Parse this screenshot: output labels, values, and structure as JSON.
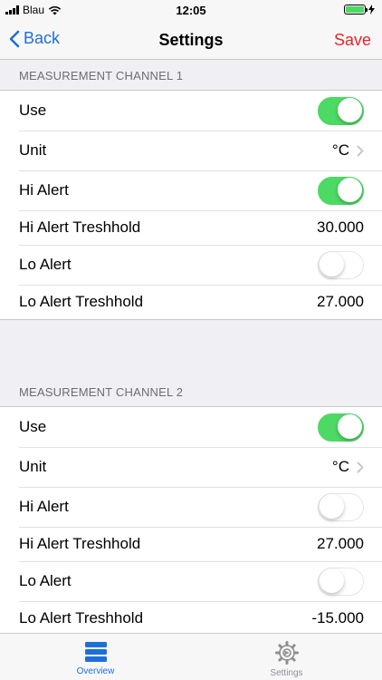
{
  "status_bar": {
    "carrier": "Blau",
    "time": "12:05"
  },
  "nav": {
    "back_label": "Back",
    "title": "Settings",
    "save_label": "Save"
  },
  "sections": [
    {
      "header": "MEASUREMENT CHANNEL 1",
      "use_label": "Use",
      "use_on": true,
      "unit_label": "Unit",
      "unit_value": "°C",
      "hi_alert_label": "Hi Alert",
      "hi_alert_on": true,
      "hi_threshold_label": "Hi Alert Treshhold",
      "hi_threshold_value": "30.000",
      "lo_alert_label": "Lo Alert",
      "lo_alert_on": false,
      "lo_threshold_label": "Lo Alert Treshhold",
      "lo_threshold_value": "27.000"
    },
    {
      "header": "MEASUREMENT CHANNEL 2",
      "use_label": "Use",
      "use_on": true,
      "unit_label": "Unit",
      "unit_value": "°C",
      "hi_alert_label": "Hi Alert",
      "hi_alert_on": false,
      "hi_threshold_label": "Hi Alert Treshhold",
      "hi_threshold_value": "27.000",
      "lo_alert_label": "Lo Alert",
      "lo_alert_on": false,
      "lo_threshold_label": "Lo Alert Treshhold",
      "lo_threshold_value": "-15.000"
    }
  ],
  "tabs": [
    {
      "label": "Overview",
      "icon": "list-icon",
      "active": true
    },
    {
      "label": "Settings",
      "icon": "gear-icon",
      "active": false
    }
  ],
  "colors": {
    "accent": "#1e6fd9",
    "save": "#e8242a",
    "toggle_on": "#4cd964"
  }
}
